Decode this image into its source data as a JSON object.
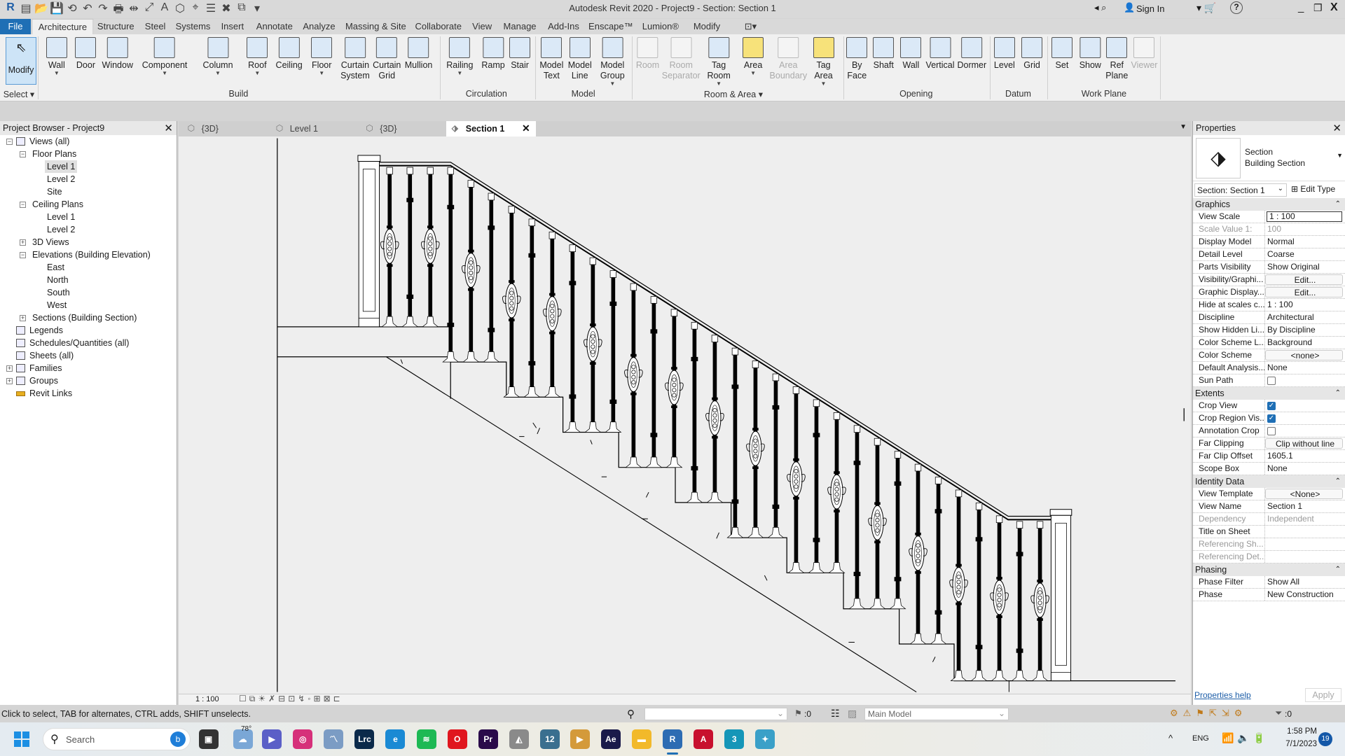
{
  "window": {
    "title": "Autodesk Revit 2020 - Project9 - Section: Section 1",
    "sign_in": "Sign In",
    "minimize": "_",
    "restore": "❐",
    "close": "X",
    "help": "?"
  },
  "quick_access": [
    "R",
    "▤",
    "📂",
    "💾",
    "⟲",
    "↶",
    "↷",
    "🖶",
    "⇹",
    "⤢",
    "A",
    "⬡",
    "⌖",
    "☰",
    "✖",
    "⧉",
    "▾"
  ],
  "ribbon_tabs": {
    "file": "File",
    "tabs": [
      "Architecture",
      "Structure",
      "Steel",
      "Systems",
      "Insert",
      "Annotate",
      "Analyze",
      "Massing & Site",
      "Collaborate",
      "View",
      "Manage",
      "Add-Ins",
      "Enscape™",
      "Lumion®",
      "Modify",
      "⊡▾"
    ],
    "active": "Architecture"
  },
  "ribbon": {
    "modify": "Modify",
    "buttons": [
      {
        "label": "Wall",
        "icon": "wall-icon",
        "dd": true
      },
      {
        "label": "Door",
        "icon": "door-icon"
      },
      {
        "label": "Window",
        "icon": "window-icon"
      },
      {
        "label": "Component",
        "icon": "component-icon",
        "dd": true
      },
      {
        "label": "Column",
        "icon": "column-icon",
        "dd": true
      },
      {
        "label": "Roof",
        "icon": "roof-icon",
        "dd": true
      },
      {
        "label": "Ceiling",
        "icon": "ceiling-icon"
      },
      {
        "label": "Floor",
        "icon": "floor-icon",
        "dd": true
      },
      {
        "label": "Curtain\nSystem",
        "icon": "curtain-system-icon"
      },
      {
        "label": "Curtain\nGrid",
        "icon": "curtain-grid-icon"
      },
      {
        "label": "Mullion",
        "icon": "mullion-icon"
      },
      {
        "label": "Railing",
        "icon": "railing-icon",
        "dd": true
      },
      {
        "label": "Ramp",
        "icon": "ramp-icon"
      },
      {
        "label": "Stair",
        "icon": "stair-icon"
      },
      {
        "label": "Model\nText",
        "icon": "model-text-icon"
      },
      {
        "label": "Model\nLine",
        "icon": "model-line-icon"
      },
      {
        "label": "Model\nGroup",
        "icon": "model-group-icon",
        "dd": true
      },
      {
        "label": "Room",
        "icon": "room-icon",
        "disabled": true
      },
      {
        "label": "Room\nSeparator",
        "icon": "room-separator-icon",
        "disabled": true
      },
      {
        "label": "Tag\nRoom",
        "icon": "tag-room-icon",
        "dd": true
      },
      {
        "label": "Area",
        "icon": "area-icon",
        "dd": true,
        "yellow": true
      },
      {
        "label": "Area\nBoundary",
        "icon": "area-boundary-icon",
        "disabled": true
      },
      {
        "label": "Tag\nArea",
        "icon": "tag-area-icon",
        "dd": true,
        "yellow": true
      },
      {
        "label": "By\nFace",
        "icon": "by-face-icon"
      },
      {
        "label": "Shaft",
        "icon": "shaft-icon"
      },
      {
        "label": "Wall",
        "icon": "wall-opening-icon"
      },
      {
        "label": "Vertical",
        "icon": "vertical-icon"
      },
      {
        "label": "Dormer",
        "icon": "dormer-icon"
      },
      {
        "label": "Level",
        "icon": "level-icon"
      },
      {
        "label": "Grid",
        "icon": "grid-icon"
      },
      {
        "label": "Set",
        "icon": "set-icon"
      },
      {
        "label": "Show",
        "icon": "show-icon"
      },
      {
        "label": "Ref\nPlane",
        "icon": "ref-plane-icon"
      },
      {
        "label": "Viewer",
        "icon": "viewer-icon",
        "disabled": true
      }
    ],
    "panels": [
      "Select ▾",
      "Build",
      "Circulation",
      "Model",
      "Room & Area ▾",
      "Opening",
      "Datum",
      "Work Plane"
    ]
  },
  "project_browser": {
    "title": "Project Browser - Project9",
    "items": [
      {
        "label": "Views (all)",
        "level": 0,
        "exp": "-",
        "icon": "views-icon"
      },
      {
        "label": "Floor Plans",
        "level": 1,
        "exp": "-"
      },
      {
        "label": "Level 1",
        "level": 2,
        "selected": true
      },
      {
        "label": "Level 2",
        "level": 2
      },
      {
        "label": "Site",
        "level": 2
      },
      {
        "label": "Ceiling Plans",
        "level": 1,
        "exp": "-"
      },
      {
        "label": "Level 1",
        "level": 2
      },
      {
        "label": "Level 2",
        "level": 2
      },
      {
        "label": "3D Views",
        "level": 1,
        "exp": "+"
      },
      {
        "label": "Elevations (Building Elevation)",
        "level": 1,
        "exp": "-"
      },
      {
        "label": "East",
        "level": 2
      },
      {
        "label": "North",
        "level": 2
      },
      {
        "label": "South",
        "level": 2
      },
      {
        "label": "West",
        "level": 2
      },
      {
        "label": "Sections (Building Section)",
        "level": 1,
        "exp": "+"
      },
      {
        "label": "Legends",
        "level": 0,
        "icon": "legends-icon"
      },
      {
        "label": "Schedules/Quantities (all)",
        "level": 0,
        "icon": "schedules-icon"
      },
      {
        "label": "Sheets (all)",
        "level": 0,
        "icon": "sheets-icon"
      },
      {
        "label": "Families",
        "level": 0,
        "exp": "+",
        "icon": "families-icon"
      },
      {
        "label": "Groups",
        "level": 0,
        "exp": "+",
        "icon": "groups-icon"
      },
      {
        "label": "Revit Links",
        "level": 0,
        "icon": "revit-links-icon"
      }
    ]
  },
  "view_tabs": [
    {
      "label": "{3D}",
      "icon": "3d-view-icon"
    },
    {
      "label": "Level 1",
      "icon": "floor-plan-icon"
    },
    {
      "label": "{3D}",
      "icon": "3d-view-icon"
    },
    {
      "label": "Section 1",
      "icon": "section-icon",
      "active": true
    }
  ],
  "view_control": {
    "scale": "1 : 100"
  },
  "properties": {
    "title": "Properties",
    "type_family": "Section",
    "type_name": "Building Section",
    "selector": "Section: Section 1",
    "edit_type": "Edit Type",
    "groups": [
      {
        "name": "Graphics",
        "rows": [
          {
            "k": "View Scale",
            "v": "1 : 100",
            "kind": "input"
          },
          {
            "k": "Scale Value    1:",
            "v": "100",
            "kind": "dis"
          },
          {
            "k": "Display Model",
            "v": "Normal"
          },
          {
            "k": "Detail Level",
            "v": "Coarse"
          },
          {
            "k": "Parts Visibility",
            "v": "Show Original"
          },
          {
            "k": "Visibility/Graphi...",
            "v": "Edit...",
            "kind": "btn"
          },
          {
            "k": "Graphic Display...",
            "v": "Edit...",
            "kind": "btn"
          },
          {
            "k": "Hide at scales c...",
            "v": "1 : 100"
          },
          {
            "k": "Discipline",
            "v": "Architectural"
          },
          {
            "k": "Show Hidden Li...",
            "v": "By Discipline"
          },
          {
            "k": "Color Scheme L...",
            "v": "Background"
          },
          {
            "k": "Color Scheme",
            "v": "<none>",
            "kind": "btn"
          },
          {
            "k": "Default Analysis...",
            "v": "None"
          },
          {
            "k": "Sun Path",
            "checked": false,
            "kind": "cb"
          }
        ]
      },
      {
        "name": "Extents",
        "rows": [
          {
            "k": "Crop View",
            "checked": true,
            "kind": "cb"
          },
          {
            "k": "Crop Region Vis...",
            "checked": true,
            "kind": "cb"
          },
          {
            "k": "Annotation Crop",
            "checked": false,
            "kind": "cb"
          },
          {
            "k": "Far Clipping",
            "v": "Clip without line",
            "kind": "btn"
          },
          {
            "k": "Far Clip Offset",
            "v": "1605.1"
          },
          {
            "k": "Scope Box",
            "v": "None"
          }
        ]
      },
      {
        "name": "Identity Data",
        "rows": [
          {
            "k": "View Template",
            "v": "<None>",
            "kind": "btn"
          },
          {
            "k": "View Name",
            "v": "Section 1"
          },
          {
            "k": "Dependency",
            "v": "Independent",
            "kind": "dis"
          },
          {
            "k": "Title on Sheet",
            "v": ""
          },
          {
            "k": "Referencing Sh...",
            "v": "",
            "kind": "dis"
          },
          {
            "k": "Referencing Det...",
            "v": "",
            "kind": "dis"
          }
        ]
      },
      {
        "name": "Phasing",
        "rows": [
          {
            "k": "Phase Filter",
            "v": "Show All"
          },
          {
            "k": "Phase",
            "v": "New Construction"
          }
        ]
      }
    ],
    "help": "Properties help",
    "apply": "Apply"
  },
  "status": {
    "message": "Click to select, TAB for alternates, CTRL adds, SHIFT unselects.",
    "filter_count": ":0",
    "workset": "Main Model",
    "selection_count": ":0"
  },
  "taskbar": {
    "search": "Search",
    "weather": "78°",
    "apps": [
      {
        "name": "task-view",
        "glyph": "▣",
        "color": "#333"
      },
      {
        "name": "weather",
        "glyph": "☁",
        "color": "#7aa7d6"
      },
      {
        "name": "teams",
        "glyph": "▶",
        "color": "#5b5fc7"
      },
      {
        "name": "instagram",
        "glyph": "◎",
        "color": "#d6307a"
      },
      {
        "name": "monitor",
        "glyph": "〽",
        "color": "#7b9cc4"
      },
      {
        "name": "lightroom",
        "glyph": "Lrc",
        "color": "#0b2a4a"
      },
      {
        "name": "edge",
        "glyph": "e",
        "color": "#1a8ad4"
      },
      {
        "name": "spotify",
        "glyph": "≋",
        "color": "#1db954"
      },
      {
        "name": "opera",
        "glyph": "O",
        "color": "#e0161e"
      },
      {
        "name": "premiere",
        "glyph": "Pr",
        "color": "#2a0a4a"
      },
      {
        "name": "formit",
        "glyph": "◭",
        "color": "#8a8a8a"
      },
      {
        "name": "revit12",
        "glyph": "12",
        "color": "#3a6f8f"
      },
      {
        "name": "media-player",
        "glyph": "▶",
        "color": "#d49a3a"
      },
      {
        "name": "after-effects",
        "glyph": "Ae",
        "color": "#1a1a4a"
      },
      {
        "name": "file-explorer",
        "glyph": "▬",
        "color": "#f2b92a"
      },
      {
        "name": "revit",
        "glyph": "R",
        "color": "#2d6cb3"
      },
      {
        "name": "autocad",
        "glyph": "A",
        "color": "#c8102e"
      },
      {
        "name": "3ds-max",
        "glyph": "3",
        "color": "#1596b8"
      },
      {
        "name": "app-globe",
        "glyph": "✦",
        "color": "#3aa0c8"
      }
    ],
    "lang": "ENG",
    "time": "1:58 PM",
    "date": "7/1/2023",
    "notifications": "19"
  }
}
